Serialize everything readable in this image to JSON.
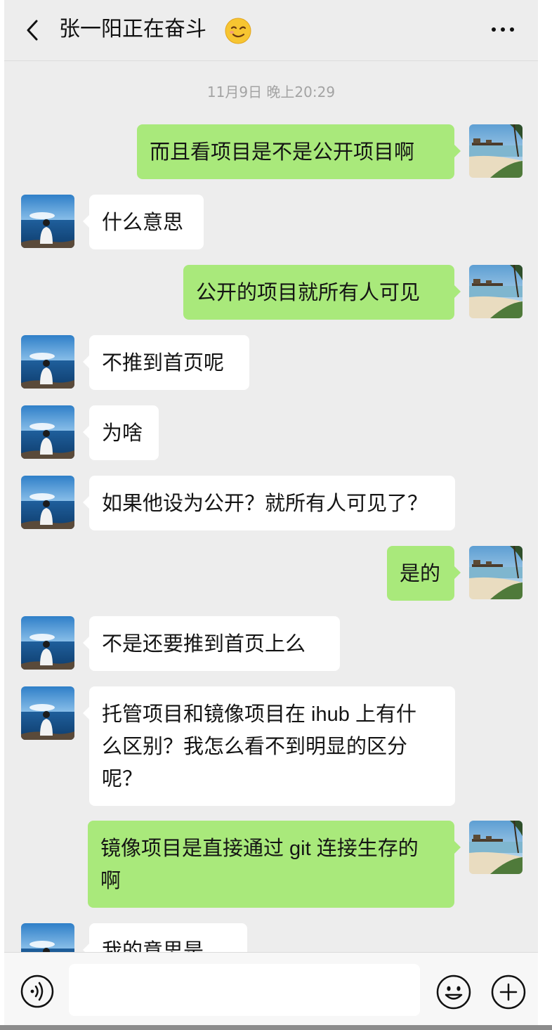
{
  "header": {
    "title": "张一阳正在奋斗",
    "back_icon": "chevron-left-icon",
    "more_icon": "more-horizontal-icon",
    "status_emoji": "wink-emoji"
  },
  "chat": {
    "timestamp": "11月9日 晚上20:29",
    "messages": [
      {
        "from": "me",
        "text": "而且看项目是不是公开项目啊"
      },
      {
        "from": "them",
        "text": "什么意思"
      },
      {
        "from": "me",
        "text": "公开的项目就所有人可见"
      },
      {
        "from": "them",
        "text": "不推到首页呢"
      },
      {
        "from": "them",
        "text": "为啥"
      },
      {
        "from": "them",
        "text": "如果他设为公开？就所有人可见了？"
      },
      {
        "from": "me",
        "text": "是的"
      },
      {
        "from": "them",
        "text": "不是还要推到首页上么"
      },
      {
        "from": "them",
        "lines": [
          "托管项目和镜像项目在 ihub 上有什",
          "么区别？我怎么看不到明显的区分",
          "呢？"
        ]
      },
      {
        "from": "me",
        "lines": [
          "镜像项目是直接通过 git 连接生存的",
          "啊"
        ]
      },
      {
        "from": "them",
        "text": "我的意思是"
      }
    ]
  },
  "input_bar": {
    "voice_icon": "voice-icon",
    "input_value": "",
    "emoji_icon": "smiley-icon",
    "plus_icon": "plus-circle-icon"
  },
  "colors": {
    "background": "#ededed",
    "outgoing_bubble": "#a9e97b",
    "incoming_bubble": "#ffffff"
  }
}
